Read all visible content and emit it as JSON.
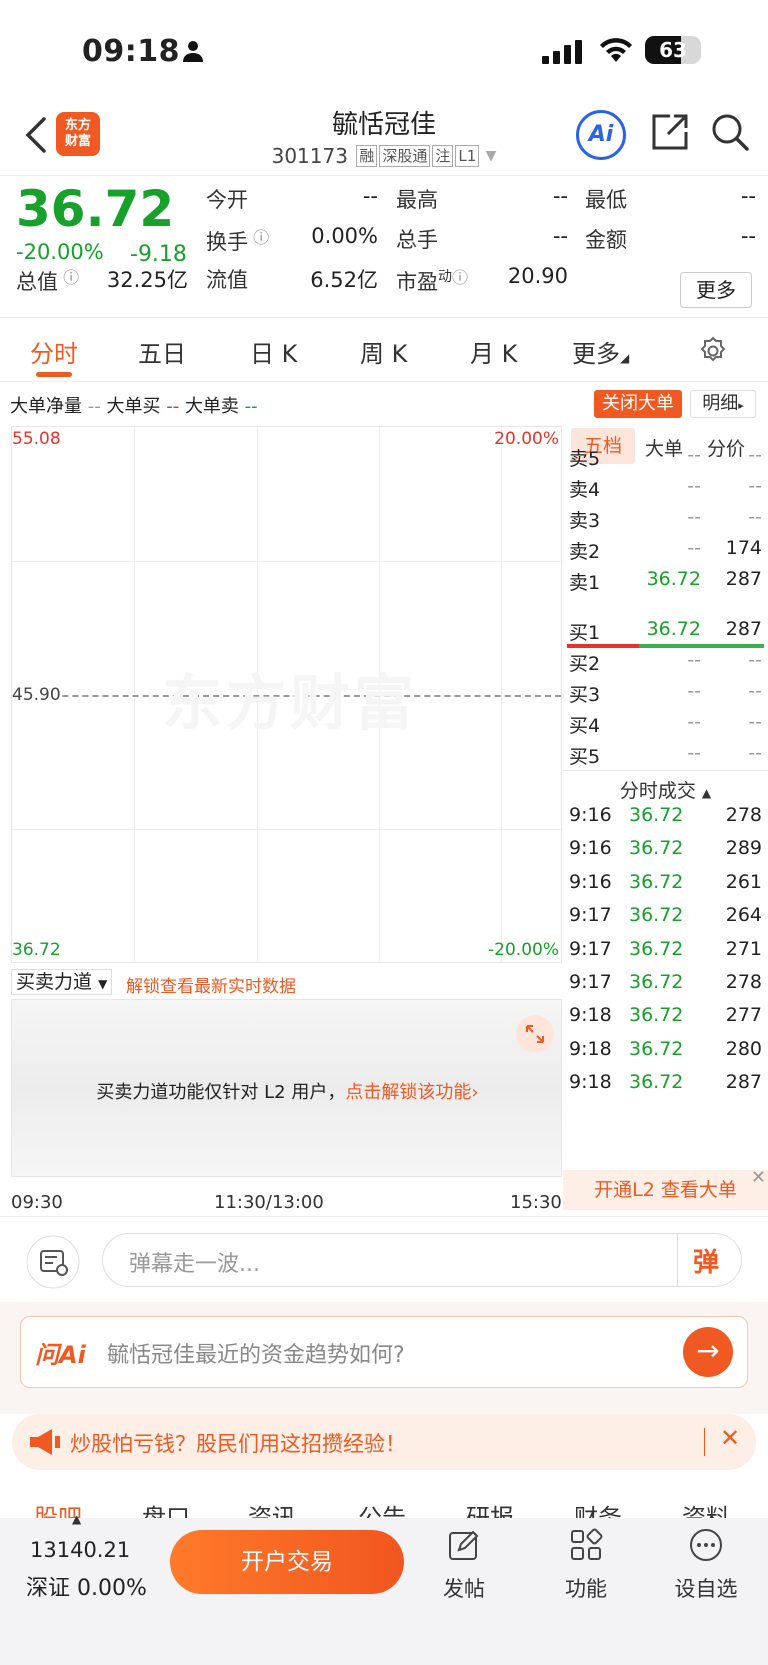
{
  "status_bar": {
    "time": "09:18",
    "battery": "63"
  },
  "header": {
    "logo_line1": "东方",
    "logo_line2": "财富",
    "title": "毓恬冠佳",
    "code": "301173",
    "tags": [
      "融",
      "深股通",
      "注",
      "L1"
    ],
    "ai_label": "Ai"
  },
  "quote": {
    "price": "36.72",
    "change_pct": "-20.00%",
    "change": "-9.18",
    "fields": [
      {
        "label": "今开",
        "value": "--"
      },
      {
        "label": "最高",
        "value": "--"
      },
      {
        "label": "最低",
        "value": "--"
      },
      {
        "label": "换手",
        "value": "0.00%"
      },
      {
        "label": "总手",
        "value": "--"
      },
      {
        "label": "金额",
        "value": "--"
      },
      {
        "label": "总值",
        "value": "32.25亿"
      },
      {
        "label": "流值",
        "value": "6.52亿"
      },
      {
        "label": "市盈",
        "sup": "动",
        "value": "20.90"
      }
    ],
    "more": "更多"
  },
  "tabs": [
    "分时",
    "五日",
    "日 K",
    "周 K",
    "月 K",
    "更多"
  ],
  "big_order": {
    "net_label": "大单净量",
    "net_value": "--",
    "buy_label": "大单买",
    "buy_value": "--",
    "sell_label": "大单卖",
    "sell_value": "--",
    "close_btn": "关闭大单",
    "detail_btn": "明细"
  },
  "chart": {
    "top_left": "55.08",
    "top_right": "20.00%",
    "mid_left": "45.90",
    "bottom_left": "36.72",
    "bottom_right": "-20.00%",
    "watermark": "东方财富",
    "time_start": "09:30",
    "time_mid": "11:30/13:00",
    "time_end": "15:30"
  },
  "side_tabs": [
    "五档",
    "大单",
    "分价"
  ],
  "sell_book": [
    {
      "label": "卖5",
      "price": "--",
      "vol": "--"
    },
    {
      "label": "卖4",
      "price": "--",
      "vol": "--"
    },
    {
      "label": "卖3",
      "price": "--",
      "vol": "--"
    },
    {
      "label": "卖2",
      "price": "--",
      "vol": "174"
    },
    {
      "label": "卖1",
      "price": "36.72",
      "vol": "287"
    }
  ],
  "buy_book": [
    {
      "label": "买1",
      "price": "36.72",
      "vol": "287"
    },
    {
      "label": "买2",
      "price": "--",
      "vol": "--"
    },
    {
      "label": "买3",
      "price": "--",
      "vol": "--"
    },
    {
      "label": "买4",
      "price": "--",
      "vol": "--"
    },
    {
      "label": "买5",
      "price": "--",
      "vol": "--"
    }
  ],
  "trades_title": "分时成交",
  "trades": [
    {
      "time": "9:16",
      "price": "36.72",
      "vol": "278"
    },
    {
      "time": "9:16",
      "price": "36.72",
      "vol": "289"
    },
    {
      "time": "9:16",
      "price": "36.72",
      "vol": "261"
    },
    {
      "time": "9:17",
      "price": "36.72",
      "vol": "264"
    },
    {
      "time": "9:17",
      "price": "36.72",
      "vol": "271"
    },
    {
      "time": "9:17",
      "price": "36.72",
      "vol": "278"
    },
    {
      "time": "9:18",
      "price": "36.72",
      "vol": "277"
    },
    {
      "time": "9:18",
      "price": "36.72",
      "vol": "280"
    },
    {
      "time": "9:18",
      "price": "36.72",
      "vol": "287"
    }
  ],
  "l2_bar": "开通L2 查看大单",
  "bsp": {
    "selector": "买卖力道",
    "unlock": "解锁查看最新实时数据",
    "msg_prefix": "买卖力道功能仅针对 L2 用户，",
    "msg_link": "点击解锁该功能"
  },
  "barrage": {
    "placeholder": "弹幕走一波...",
    "btn": "弹"
  },
  "ask": {
    "brand": "问Ai",
    "question": "毓恬冠佳最近的资金趋势如何?"
  },
  "promo": {
    "text": "炒股怕亏钱？股民们用这招攒经验！"
  },
  "subtabs": [
    "股吧",
    "盘口",
    "资讯",
    "公告",
    "研报",
    "财务",
    "资料"
  ],
  "bottom": {
    "index_value": "13140.21",
    "index_name": "深证",
    "index_change": "0.00%",
    "trade_btn": "开户交易",
    "post": "发帖",
    "func": "功能",
    "watch": "设自选"
  },
  "colors": {
    "accent": "#f05a22",
    "down": "#17a02a",
    "up": "#e5332a",
    "ai_blue": "#2b62e8"
  }
}
